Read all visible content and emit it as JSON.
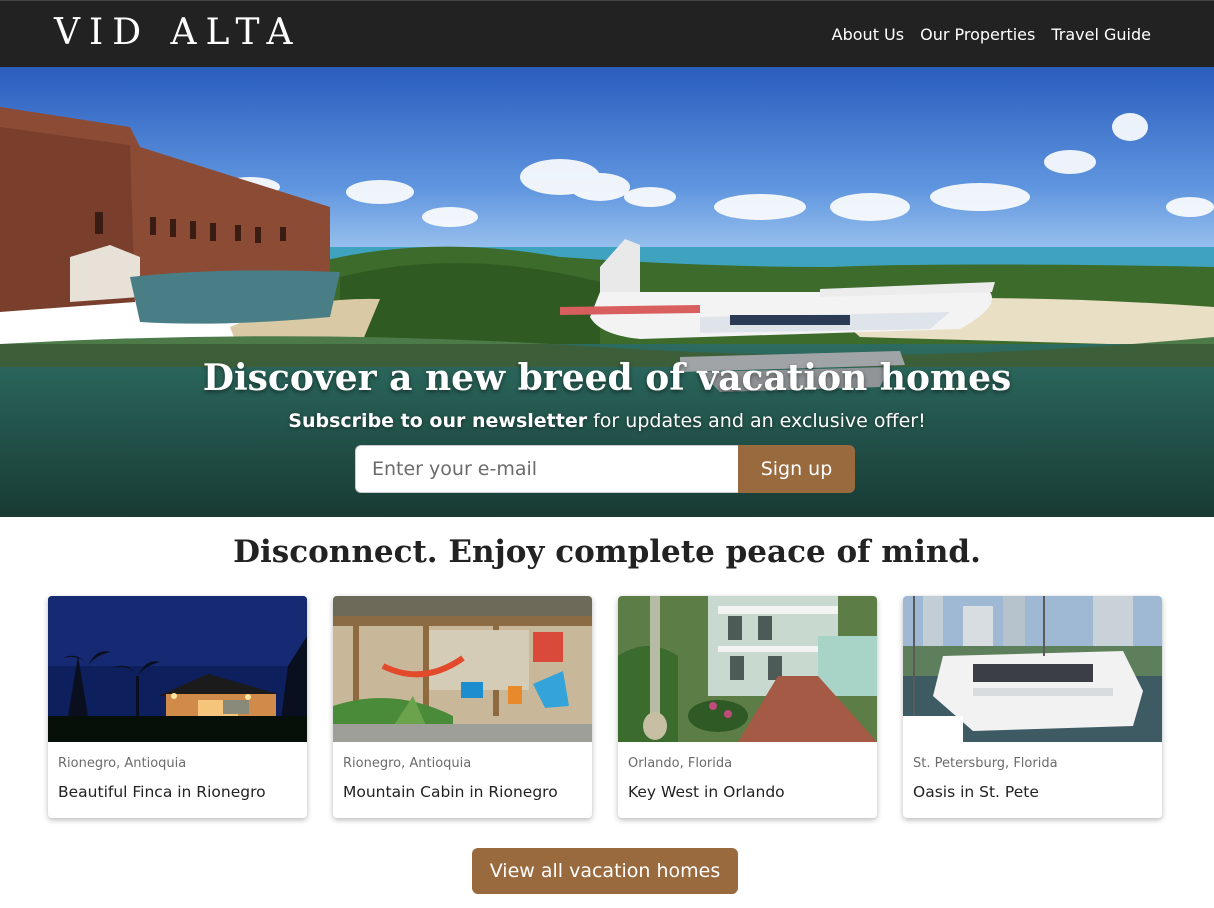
{
  "nav": {
    "logo_text": "VIDALTA",
    "links": [
      {
        "label": "About Us"
      },
      {
        "label": "Our Properties"
      },
      {
        "label": "Travel Guide"
      }
    ]
  },
  "hero": {
    "title": "Discover a new breed of vacation homes",
    "subtitle_bold": "Subscribe to our newsletter",
    "subtitle_rest": " for updates and an exclusive offer!",
    "email_placeholder": "Enter your e-mail",
    "email_value": "",
    "signup_label": "Sign up"
  },
  "section": {
    "title": "Disconnect. Enjoy complete peace of mind."
  },
  "cards": [
    {
      "location": "Rionegro, Antioquia",
      "name": "Beautiful Finca in Rionegro"
    },
    {
      "location": "Rionegro, Antioquia",
      "name": "Mountain Cabin in Rionegro"
    },
    {
      "location": "Orlando, Florida",
      "name": "Key West in Orlando"
    },
    {
      "location": "St. Petersburg, Florida",
      "name": "Oasis in St. Pete"
    }
  ],
  "cta": {
    "view_all_label": "View all vacation homes"
  },
  "colors": {
    "nav_bg": "#222222",
    "accent": "#9a6a3f"
  }
}
